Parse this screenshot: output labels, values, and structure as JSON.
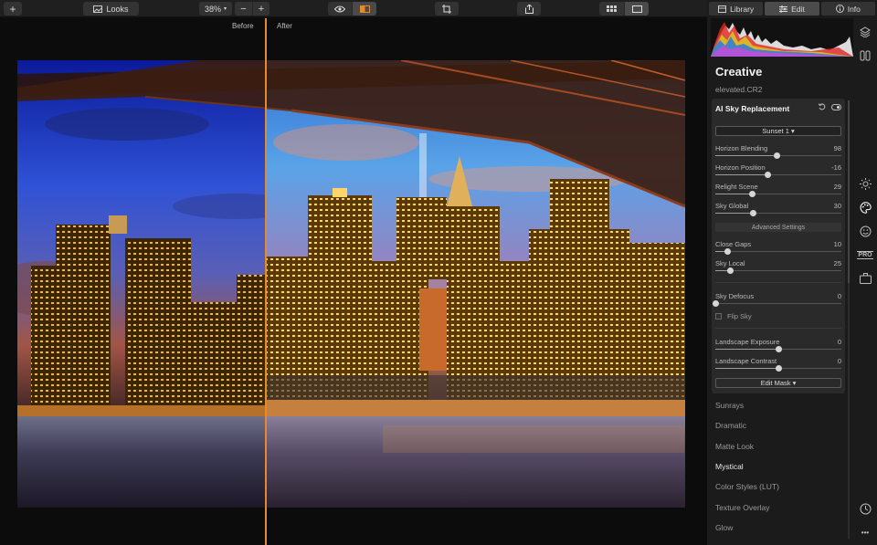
{
  "toolbar": {
    "looks_label": "Looks",
    "zoom": "38%",
    "zoom_minus": "−",
    "zoom_plus": "+",
    "add": "+"
  },
  "canvas": {
    "before_label": "Before",
    "after_label": "After",
    "split_color": "#e48a2c"
  },
  "panel": {
    "tabs": [
      {
        "label": "Library",
        "icon": "library-icon"
      },
      {
        "label": "Edit",
        "icon": "sliders-icon",
        "active": true
      },
      {
        "label": "Info",
        "icon": "info-icon"
      }
    ],
    "section_title": "Creative",
    "filename": "elevated.CR2",
    "tool": {
      "title": "AI Sky Replacement",
      "preset": "Sunset 1 ▾",
      "sliders_top": [
        {
          "label": "Horizon Blending",
          "value": "98",
          "level": 0.49
        },
        {
          "label": "Horizon Position",
          "value": "-16",
          "level": 0.42
        },
        {
          "label": "Relight Scene",
          "value": "29",
          "level": 0.29
        },
        {
          "label": "Sky Global",
          "value": "30",
          "level": 0.3
        }
      ],
      "advanced_label": "Advanced Settings",
      "sliders_adv": [
        {
          "label": "Close Gaps",
          "value": "10",
          "level": 0.1
        },
        {
          "label": "Sky Local",
          "value": "25",
          "level": 0.12
        }
      ],
      "sky_defocus": {
        "label": "Sky Defocus",
        "value": "0",
        "level": 0
      },
      "flip_sky": "Flip Sky",
      "sliders_landscape": [
        {
          "label": "Landscape Exposure",
          "value": "0",
          "level": 0.5
        },
        {
          "label": "Landscape Contrast",
          "value": "0",
          "level": 0.5
        }
      ],
      "edit_mask": "Edit Mask ▾"
    },
    "filters": [
      "Sunrays",
      "Dramatic",
      "Matte Look",
      "Mystical",
      "Color Styles (LUT)",
      "Texture Overlay",
      "Glow"
    ],
    "highlighted_filter": "Mystical",
    "side_icons": [
      "layers-icon",
      "compare-icon",
      "sun-icon",
      "palette-icon",
      "face-icon",
      "pro-icon",
      "briefcase-icon",
      "history-icon",
      "more-icon"
    ],
    "pro_label": "PRO",
    "more_label": "•••"
  }
}
